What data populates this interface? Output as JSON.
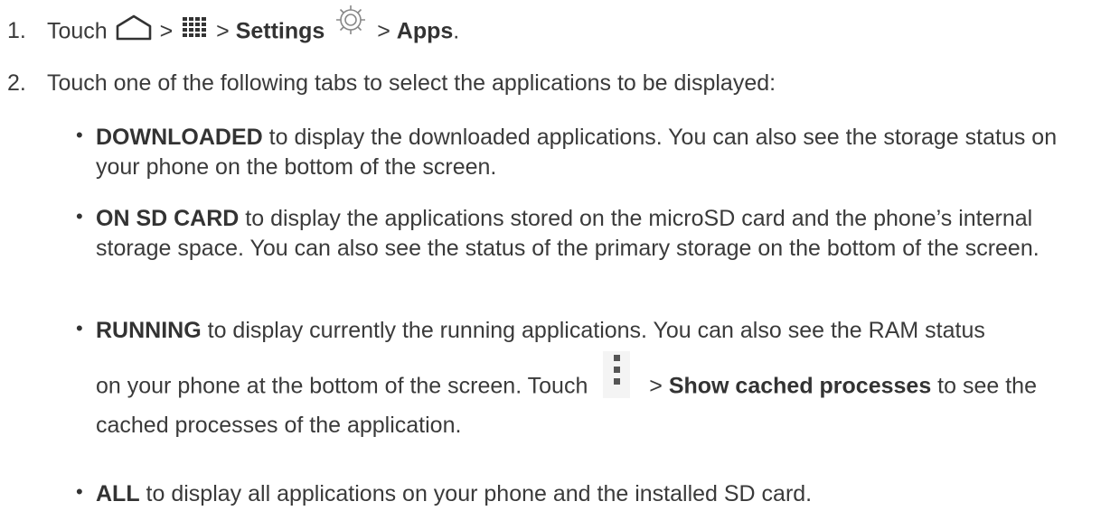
{
  "steps": [
    {
      "number": "1.",
      "touch": "Touch",
      "sep1": ">",
      "sep2": ">",
      "settings": "Settings",
      "sep3": ">",
      "apps": "Apps",
      "end": "."
    },
    {
      "number": "2.",
      "text": "Touch one of the following tabs to select the applications to be displayed:"
    }
  ],
  "bullets": [
    {
      "bold": "DOWNLOADED",
      "text": " to display the downloaded applications. You can also see the storage status on your phone on the bottom of the screen."
    },
    {
      "bold": "ON SD CARD",
      "text": " to display the applications stored on the microSD card and the phone’s internal storage space. You can also see the status of the primary storage on the bottom of the screen."
    },
    {
      "bold": "RUNNING",
      "text": " to display currently the running applications. You can also see the RAM status",
      "text2": "on your phone at the bottom of the screen. Touch",
      "sep": ">",
      "bold2": "Show cached processes",
      "text3": " to see the cached processes of the application."
    },
    {
      "bold": "ALL",
      "text": " to display all applications on your phone and the installed SD card."
    }
  ],
  "icons": [
    "home-icon",
    "apps-grid-icon",
    "settings-gear-icon",
    "menu-overflow-icon"
  ]
}
